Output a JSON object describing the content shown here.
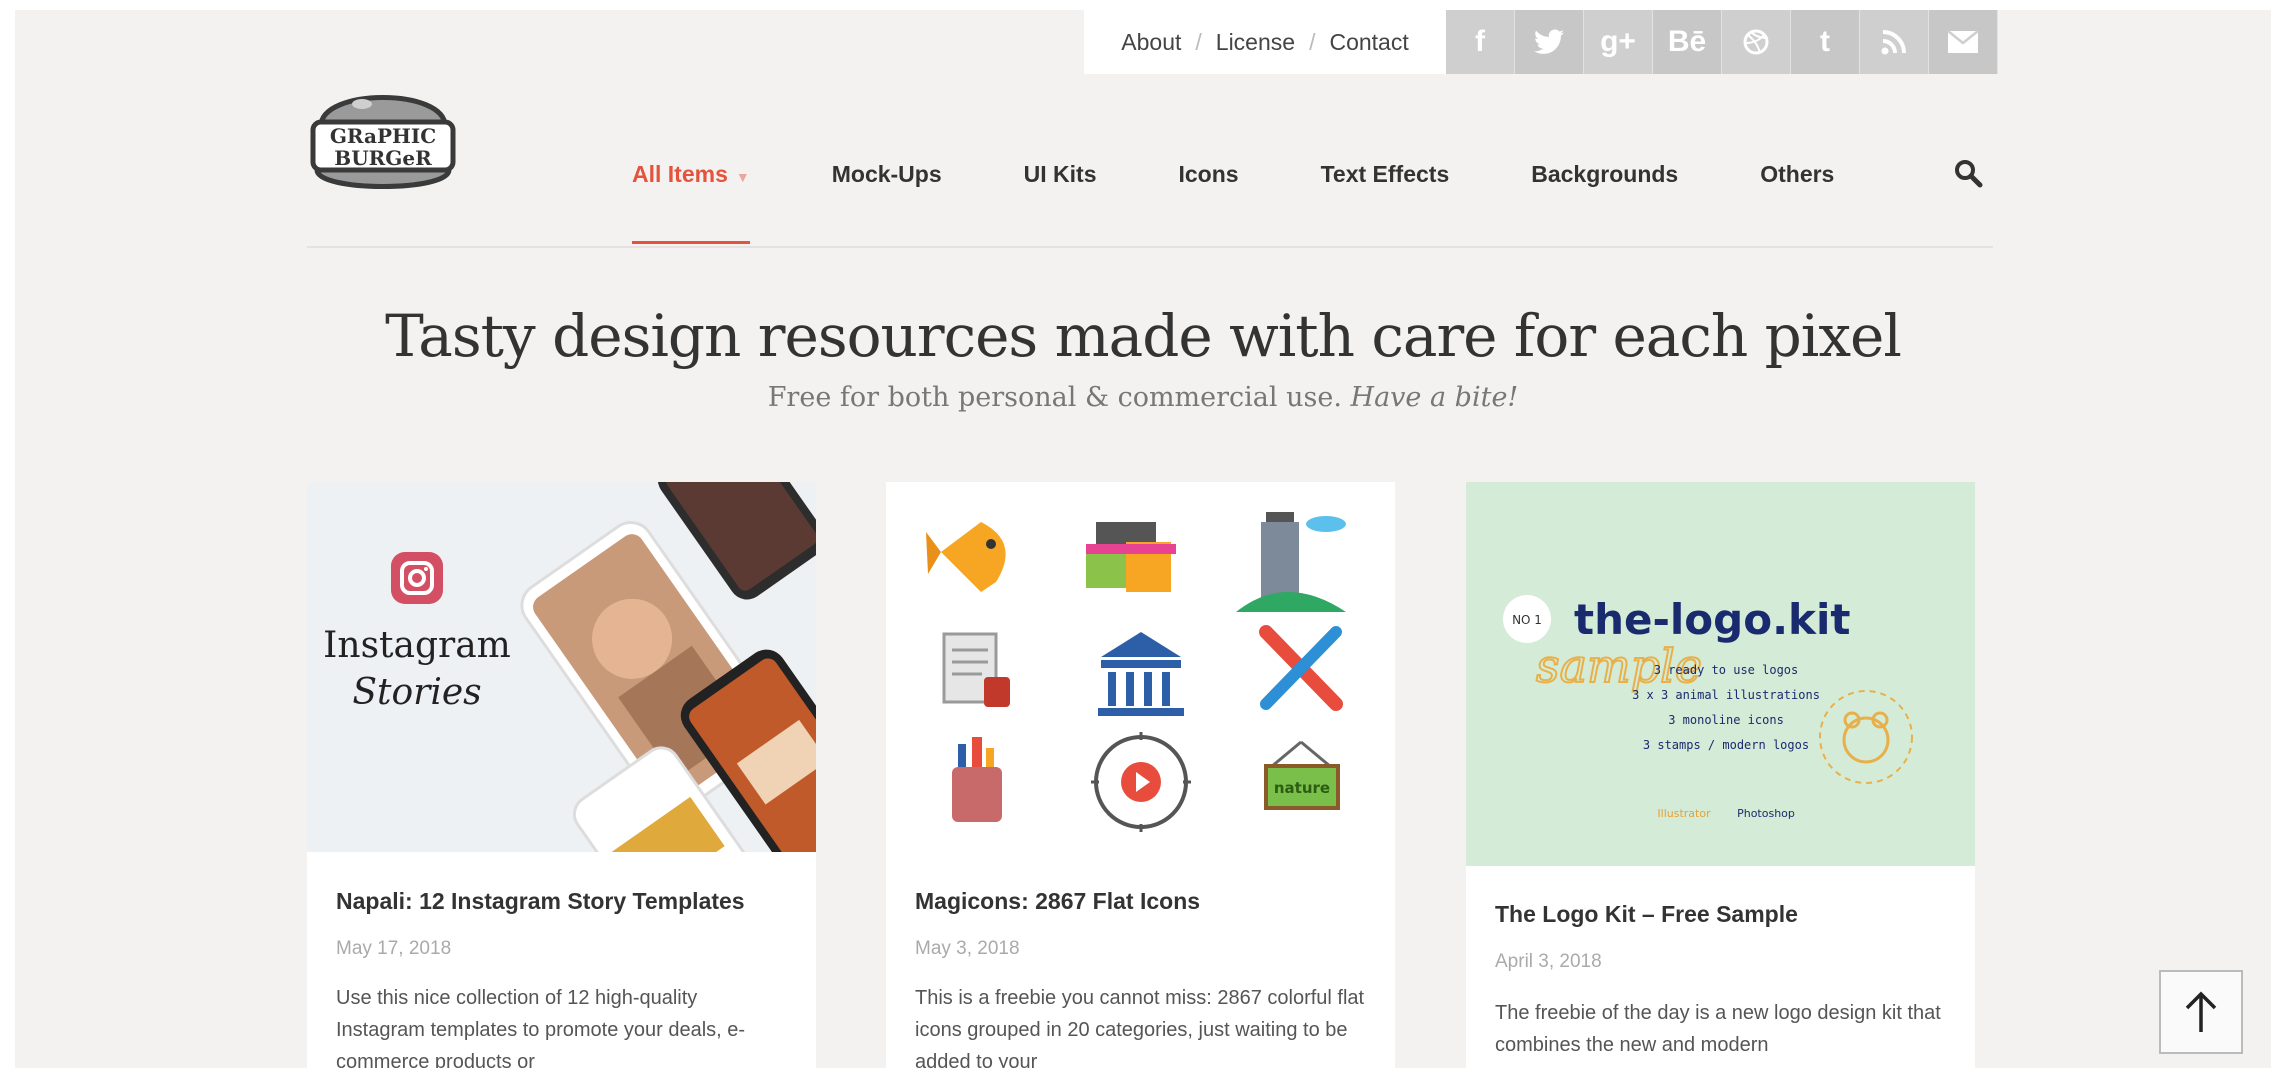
{
  "top_links": {
    "about": "About",
    "license": "License",
    "contact": "Contact",
    "separator": "/"
  },
  "socials": [
    {
      "icon": "facebook-icon",
      "glyph": "f"
    },
    {
      "icon": "twitter-icon",
      "glyph": "🐦"
    },
    {
      "icon": "google-plus-icon",
      "glyph": "g+"
    },
    {
      "icon": "behance-icon",
      "glyph": "Bē"
    },
    {
      "icon": "dribbble-icon",
      "glyph": "◎"
    },
    {
      "icon": "tumblr-icon",
      "glyph": "t"
    },
    {
      "icon": "rss-icon",
      "glyph": "◉"
    },
    {
      "icon": "mail-icon",
      "glyph": "✉"
    }
  ],
  "logo": {
    "line1": "GRaPHIC",
    "line2": "BURGeR"
  },
  "nav": {
    "all_items": "All Items",
    "mockups": "Mock-Ups",
    "ui_kits": "UI Kits",
    "icons": "Icons",
    "text_effects": "Text Effects",
    "backgrounds": "Backgrounds",
    "others": "Others"
  },
  "hero": {
    "title": "Tasty design resources made with care for each pixel",
    "subtitle": "Free for both personal & commercial use.",
    "subtitle_em": "Have a bite!"
  },
  "cards": [
    {
      "title": "Napali: 12 Instagram Story Templates",
      "date": "May 17, 2018",
      "excerpt": "Use this nice collection of 12 high-quality Instagram templates to promote your deals, e-commerce products or",
      "image_text_1": "Instagram",
      "image_text_2": "Stories"
    },
    {
      "title": "Magicons: 2867 Flat Icons",
      "date": "May 3, 2018",
      "excerpt": "This is a freebie you cannot miss: 2867 colorful flat icons grouped in 20 categories, just waiting to be added to your",
      "image_sign": "nature"
    },
    {
      "title": "The Logo Kit – Free Sample",
      "date": "April 3, 2018",
      "excerpt": "The freebie of the day is a new logo design kit that combines the new and modern",
      "image_badge": "NO 1",
      "image_headline": "the-logo.kit",
      "image_script": "sample",
      "image_lines": [
        "3 ready to use logos",
        "3 x 3 animal illustrations",
        "3 monoline icons",
        "3 stamps / modern logos"
      ],
      "image_tool1": "Illustrator",
      "image_tool2": "Photoshop"
    }
  ],
  "colors": {
    "accent": "#e5533d",
    "background": "#f3f2f0",
    "social": "#cfcfcf"
  }
}
